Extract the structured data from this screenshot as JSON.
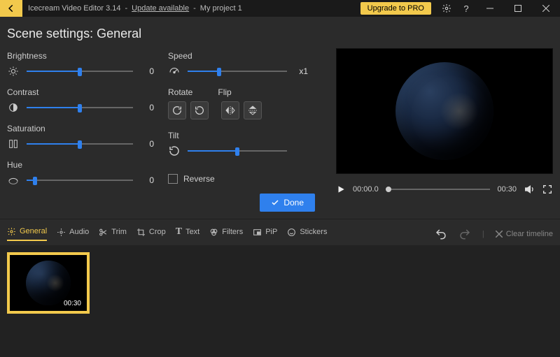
{
  "titlebar": {
    "app": "Icecream Video Editor 3.14",
    "update": "Update available",
    "project": "My project 1",
    "sep": "-",
    "upgrade": "Upgrade to PRO"
  },
  "heading": "Scene settings: General",
  "sliders": {
    "brightness": {
      "label": "Brightness",
      "value": "0"
    },
    "contrast": {
      "label": "Contrast",
      "value": "0"
    },
    "saturation": {
      "label": "Saturation",
      "value": "0"
    },
    "hue": {
      "label": "Hue",
      "value": "0"
    },
    "speed": {
      "label": "Speed",
      "value": "x1"
    },
    "tilt": {
      "label": "Tilt"
    }
  },
  "rotate_label": "Rotate",
  "flip_label": "Flip",
  "reverse_label": "Reverse",
  "done_label": "Done",
  "player": {
    "cur": "00:00.0",
    "dur": "00:30"
  },
  "tabs": {
    "general": "General",
    "audio": "Audio",
    "trim": "Trim",
    "crop": "Crop",
    "text": "Text",
    "filters": "Filters",
    "pip": "PiP",
    "stickers": "Stickers"
  },
  "clear_timeline": "Clear timeline",
  "clip_duration": "00:30"
}
